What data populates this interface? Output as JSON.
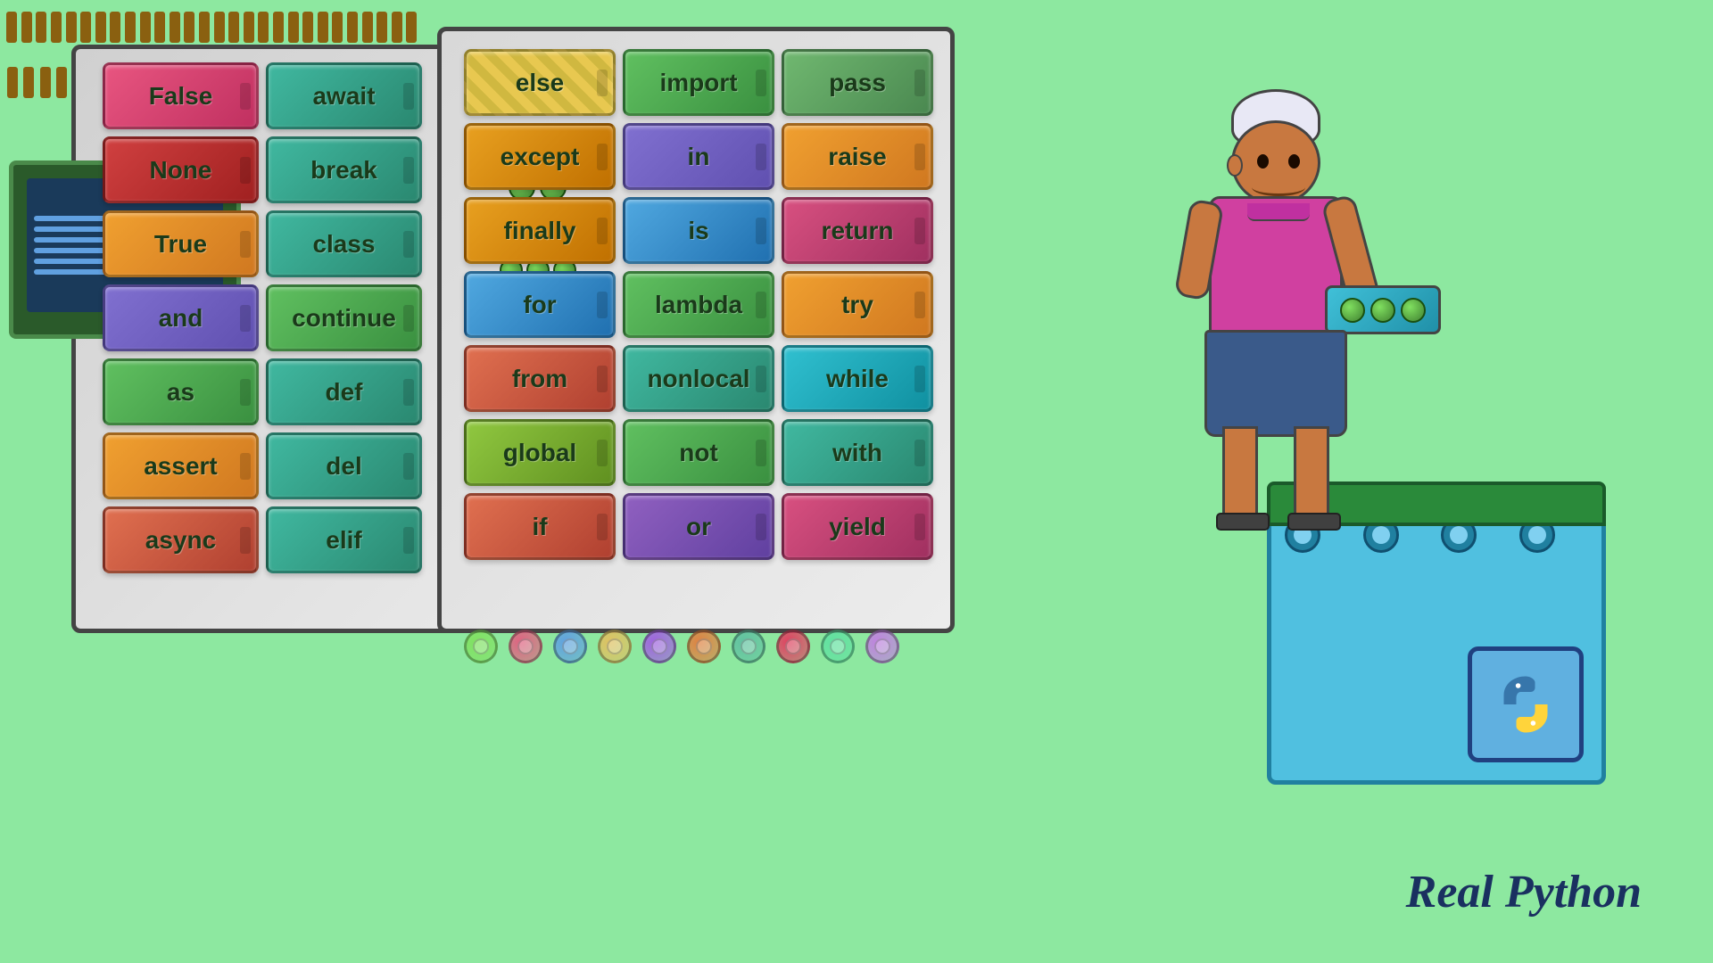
{
  "background_color": "#8de8a0",
  "brand": {
    "name": "Real Python",
    "text_color": "#1a3060"
  },
  "left_cabinet": {
    "keywords": [
      {
        "label": "False",
        "color": "c-pink"
      },
      {
        "label": "await",
        "color": "c-teal"
      },
      {
        "label": "None",
        "color": "c-red"
      },
      {
        "label": "break",
        "color": "c-teal"
      },
      {
        "label": "True",
        "color": "c-orange"
      },
      {
        "label": "class",
        "color": "c-teal"
      },
      {
        "label": "and",
        "color": "c-purple"
      },
      {
        "label": "continue",
        "color": "c-green"
      },
      {
        "label": "as",
        "color": "c-green"
      },
      {
        "label": "def",
        "color": "c-teal"
      },
      {
        "label": "assert",
        "color": "c-orange"
      },
      {
        "label": "del",
        "color": "c-teal"
      },
      {
        "label": "async",
        "color": "c-coral"
      },
      {
        "label": "elif",
        "color": "c-teal"
      }
    ]
  },
  "right_cabinet": {
    "keywords": [
      {
        "label": "else",
        "color": "c-stripe"
      },
      {
        "label": "import",
        "color": "c-green"
      },
      {
        "label": "pass",
        "color": "c-sage"
      },
      {
        "label": "except",
        "color": "c-amber"
      },
      {
        "label": "in",
        "color": "c-purple"
      },
      {
        "label": "raise",
        "color": "c-orange"
      },
      {
        "label": "finally",
        "color": "c-amber"
      },
      {
        "label": "is",
        "color": "c-sky"
      },
      {
        "label": "return",
        "color": "c-rose"
      },
      {
        "label": "for",
        "color": "c-sky"
      },
      {
        "label": "lambda",
        "color": "c-green"
      },
      {
        "label": "try",
        "color": "c-orange"
      },
      {
        "label": "from",
        "color": "c-coral"
      },
      {
        "label": "nonlocal",
        "color": "c-teal"
      },
      {
        "label": "while",
        "color": "c-cyan"
      },
      {
        "label": "global",
        "color": "c-lime"
      },
      {
        "label": "not",
        "color": "c-green"
      },
      {
        "label": "with",
        "color": "c-teal"
      },
      {
        "label": "if",
        "color": "c-coral"
      },
      {
        "label": "or",
        "color": "c-violet"
      },
      {
        "label": "yield",
        "color": "c-rose"
      }
    ]
  }
}
